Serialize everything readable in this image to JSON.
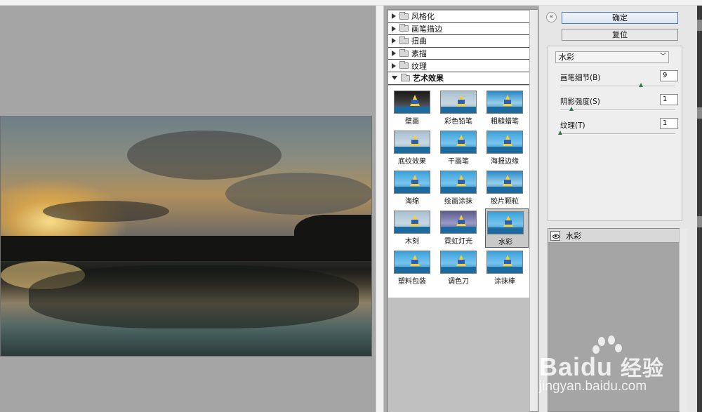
{
  "gallery": {
    "categories": [
      {
        "label": "风格化",
        "open": false
      },
      {
        "label": "画笔描边",
        "open": false
      },
      {
        "label": "扭曲",
        "open": false
      },
      {
        "label": "素描",
        "open": false
      },
      {
        "label": "纹理",
        "open": false
      },
      {
        "label": "艺术效果",
        "open": true
      }
    ],
    "filters": [
      {
        "label": "壁画"
      },
      {
        "label": "彩色铅笔"
      },
      {
        "label": "粗糙蜡笔"
      },
      {
        "label": "底纹效果"
      },
      {
        "label": "干画笔"
      },
      {
        "label": "海报边缘"
      },
      {
        "label": "海绵"
      },
      {
        "label": "绘画涂抹"
      },
      {
        "label": "胶片颗粒"
      },
      {
        "label": "木刻"
      },
      {
        "label": "霓虹灯光"
      },
      {
        "label": "水彩"
      },
      {
        "label": "塑料包装"
      },
      {
        "label": "调色刀"
      },
      {
        "label": "涂抹棒"
      }
    ],
    "selected_filter": "水彩"
  },
  "buttons": {
    "ok_label": "确定",
    "reset_label": "复位",
    "collapse_glyph": "«"
  },
  "settings": {
    "filter_select": "水彩",
    "params": [
      {
        "label": "画笔细节(B)",
        "value": "9",
        "level": 0.7
      },
      {
        "label": "阴影强度(S)",
        "value": "1",
        "level": 0.1
      },
      {
        "label": "纹理(T)",
        "value": "1",
        "level": 0.0
      }
    ]
  },
  "layers": {
    "row_label": "水彩"
  },
  "watermark": {
    "brand": "Bai",
    "brand_mid": "du",
    "brand_cn": "经验",
    "url": "jingyan.baidu.com"
  },
  "colors": {
    "ok_border": "#4a78c8",
    "slider_knob": "#2c7a3e"
  }
}
